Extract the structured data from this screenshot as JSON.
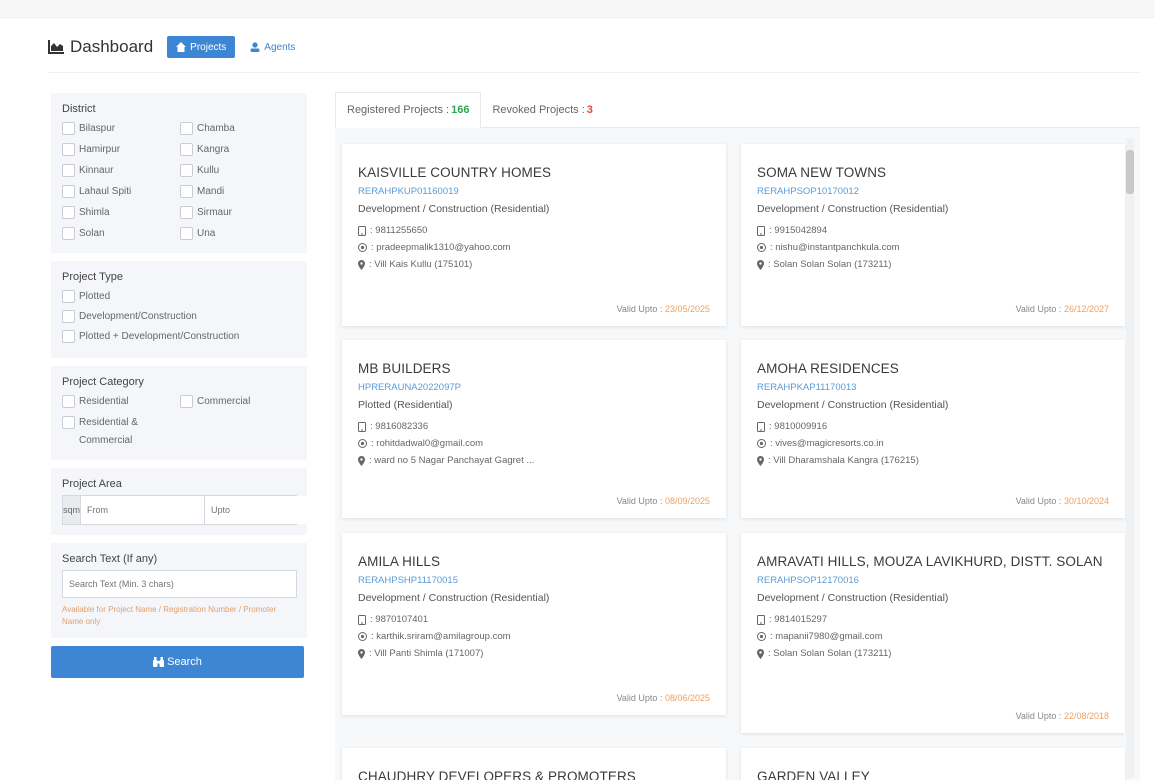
{
  "header": {
    "title": "Dashboard",
    "projects_label": "Projects",
    "agents_label": "Agents"
  },
  "sidebar": {
    "district": {
      "title": "District",
      "options": [
        "Bilaspur",
        "Chamba",
        "Hamirpur",
        "Kangra",
        "Kinnaur",
        "Kullu",
        "Lahaul Spiti",
        "Mandi",
        "Shimla",
        "Sirmaur",
        "Solan",
        "Una"
      ]
    },
    "project_type": {
      "title": "Project Type",
      "options": [
        "Plotted",
        "Development/Construction",
        "Plotted + Development/Construction"
      ]
    },
    "project_category": {
      "title": "Project Category",
      "options": [
        "Residential",
        "Commercial",
        "Residential & Commercial"
      ]
    },
    "project_area": {
      "title": "Project Area",
      "unit": "sqm",
      "from_placeholder": "From",
      "upto_placeholder": "Upto"
    },
    "search_text": {
      "title": "Search Text (If any)",
      "placeholder": "Search Text (Min. 3 chars)",
      "hint": "Available for Project Name / Registration Number / Promoter Name only"
    },
    "search_button": "Search"
  },
  "tabs": {
    "registered_label": "Registered Projects :",
    "registered_count": "166",
    "revoked_label": "Revoked Projects :",
    "revoked_count": "3"
  },
  "valid_label": "Valid Upto :",
  "cards": [
    {
      "title": "KAISVILLE COUNTRY HOMES",
      "reg": "RERAHPKUP01160019",
      "type": "Development / Construction (Residential)",
      "phone": "9811255650",
      "email": "pradeepmalik1310@yahoo.com",
      "address": "Vill Kais Kullu (175101)",
      "valid": "23/05/2025"
    },
    {
      "title": "SOMA NEW TOWNS",
      "reg": "RERAHPSOP10170012",
      "type": "Development / Construction (Residential)",
      "phone": "9915042894",
      "email": "nishu@instantpanchkula.com",
      "address": "Solan Solan Solan (173211)",
      "valid": "26/12/2027"
    },
    {
      "title": "MB BUILDERS",
      "reg": "HPRERAUNA2022097P",
      "type": "Plotted (Residential)",
      "phone": "9816082336",
      "email": "rohitdadwal0@gmail.com",
      "address": "ward no 5 Nagar Panchayat Gagret ...",
      "valid": "08/09/2025"
    },
    {
      "title": "AMOHA RESIDENCES",
      "reg": "RERAHPKAP11170013",
      "type": "Development / Construction (Residential)",
      "phone": "9810009916",
      "email": "vives@magicresorts.co.in",
      "address": "Vill Dharamshala Kangra (176215)",
      "valid": "30/10/2024"
    },
    {
      "title": "AMILA HILLS",
      "reg": "RERAHPSHP11170015",
      "type": "Development / Construction (Residential)",
      "phone": "9870107401",
      "email": "karthik.sriram@amilagroup.com",
      "address": "Vill Panti Shimla (171007)",
      "valid": "08/06/2025"
    },
    {
      "title": "AMRAVATI HILLS, MOUZA LAVIKHURD, DISTT. SOLAN",
      "reg": "RERAHPSOP12170016",
      "type": "Development / Construction (Residential)",
      "phone": "9814015297",
      "email": "mapanii7980@gmail.com",
      "address": "Solan Solan Solan (173211)",
      "valid": "22/08/2018"
    },
    {
      "title": "CHAUDHRY DEVELOPERS & PROMOTERS",
      "reg": "",
      "type": "",
      "phone": "",
      "email": "",
      "address": "",
      "valid": ""
    },
    {
      "title": "GARDEN VALLEY",
      "reg": "",
      "type": "",
      "phone": "",
      "email": "",
      "address": "",
      "valid": ""
    }
  ]
}
